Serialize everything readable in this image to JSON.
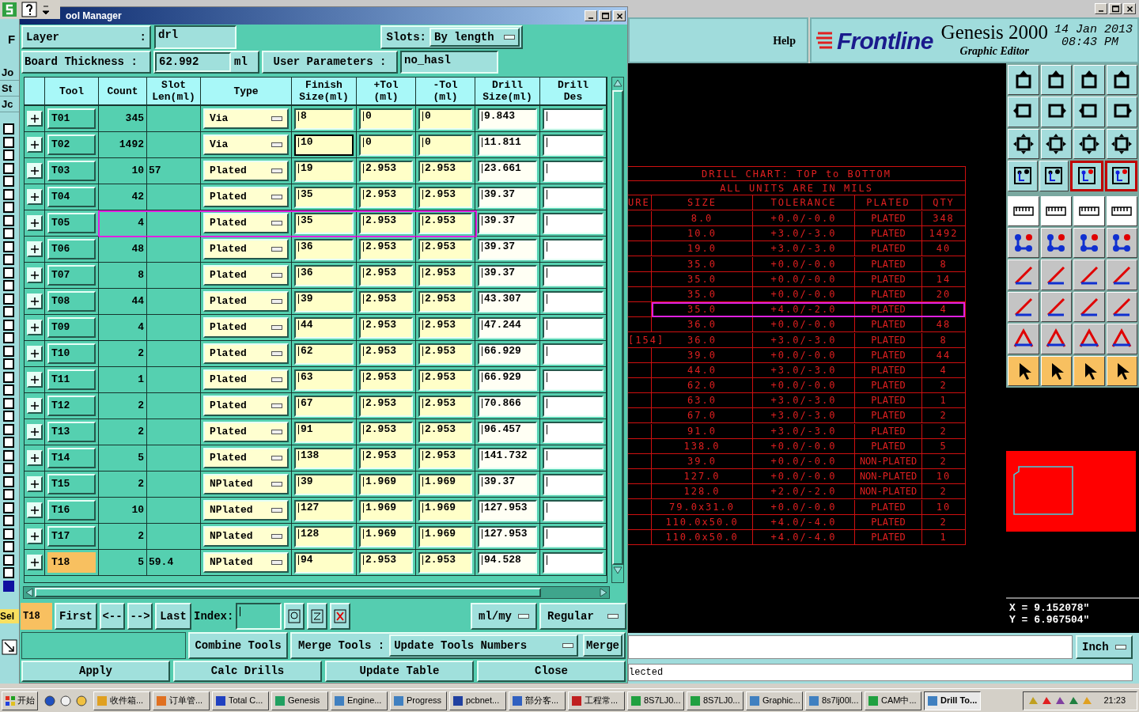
{
  "genesis": {
    "help": "Help",
    "brand": "Frontline",
    "product": "Genesis 2000",
    "subtitle": "Graphic Editor",
    "date": "14 Jan 2013",
    "time": "08:43 PM",
    "header_label": "F",
    "left_labels": [
      "Jo",
      "St",
      "Jc"
    ],
    "sel_label": "Sel",
    "layer_icons": [
      {
        "selected": false
      },
      {
        "selected": false
      },
      {
        "selected": false
      },
      {
        "selected": false
      },
      {
        "selected": false
      },
      {
        "selected": false
      },
      {
        "selected": false
      },
      {
        "selected": false
      },
      {
        "selected": false
      },
      {
        "selected": false
      },
      {
        "selected": false
      },
      {
        "selected": false
      },
      {
        "selected": false
      },
      {
        "selected": false
      },
      {
        "selected": false
      },
      {
        "selected": false
      },
      {
        "selected": false
      },
      {
        "selected": false
      },
      {
        "selected": false
      },
      {
        "selected": false
      },
      {
        "selected": false
      },
      {
        "selected": false
      },
      {
        "selected": false
      },
      {
        "selected": false
      },
      {
        "selected": false
      },
      {
        "selected": false
      },
      {
        "selected": false
      },
      {
        "selected": false
      },
      {
        "selected": false
      },
      {
        "selected": false
      },
      {
        "selected": false
      },
      {
        "selected": false
      },
      {
        "selected": false
      },
      {
        "selected": false
      },
      {
        "selected": false
      },
      {
        "selected": true
      }
    ],
    "toolbar": [
      {
        "kind": "view",
        "on": [
          false,
          false,
          false,
          false
        ]
      },
      {
        "kind": "view",
        "on": [
          false,
          false,
          false,
          false
        ]
      },
      {
        "kind": "view",
        "on": [
          false,
          false,
          false,
          false
        ]
      },
      {
        "kind": "view",
        "on": [
          false,
          false,
          true,
          true
        ]
      },
      {
        "kind": "measure",
        "on": [
          false,
          false,
          false,
          false
        ]
      },
      {
        "kind": "edit",
        "on": [
          false,
          false,
          false,
          false
        ]
      },
      {
        "kind": "edit",
        "on": [
          false,
          false,
          false,
          false
        ]
      },
      {
        "kind": "edit",
        "on": [
          false,
          false,
          false,
          false
        ]
      },
      {
        "kind": "edit",
        "on": [
          false,
          false,
          false,
          false
        ]
      },
      {
        "kind": "select",
        "on": [
          false,
          false,
          false,
          false
        ]
      }
    ],
    "coords": [
      "X = 9.152078\"",
      "Y = 6.967504\""
    ],
    "units": "Inch",
    "status": "lected"
  },
  "drill_chart": {
    "title": "DRILL CHART: TOP to BOTTOM",
    "subtitle": "ALL UNITS ARE IN MILS",
    "columns": [
      "URE",
      "SIZE",
      "TOLERANCE",
      "PLATED",
      "QTY"
    ],
    "rows": [
      {
        "size": "8.0",
        "tolerance": "+0.0/-0.0",
        "plated": "PLATED",
        "qty": "348",
        "selected": false
      },
      {
        "size": "10.0",
        "tolerance": "+3.0/-3.0",
        "plated": "PLATED",
        "qty": "1492",
        "selected": false
      },
      {
        "size": "19.0",
        "tolerance": "+3.0/-3.0",
        "plated": "PLATED",
        "qty": "40",
        "selected": false
      },
      {
        "size": "35.0",
        "tolerance": "+0.0/-0.0",
        "plated": "PLATED",
        "qty": "8",
        "selected": false
      },
      {
        "size": "35.0",
        "tolerance": "+0.0/-0.0",
        "plated": "PLATED",
        "qty": "14",
        "selected": false
      },
      {
        "size": "35.0",
        "tolerance": "+0.0/-0.0",
        "plated": "PLATED",
        "qty": "20",
        "selected": false
      },
      {
        "size": "35.0",
        "tolerance": "+4.0/-2.0",
        "plated": "PLATED",
        "qty": "4",
        "selected": true
      },
      {
        "size": "36.0",
        "tolerance": "+0.0/-0.0",
        "plated": "PLATED",
        "qty": "48",
        "selected": false
      },
      {
        "mark": "[154]",
        "size": "36.0",
        "tolerance": "+3.0/-3.0",
        "plated": "PLATED",
        "qty": "8",
        "selected": false
      },
      {
        "size": "39.0",
        "tolerance": "+0.0/-0.0",
        "plated": "PLATED",
        "qty": "44",
        "selected": false
      },
      {
        "size": "44.0",
        "tolerance": "+3.0/-3.0",
        "plated": "PLATED",
        "qty": "4",
        "selected": false
      },
      {
        "size": "62.0",
        "tolerance": "+0.0/-0.0",
        "plated": "PLATED",
        "qty": "2",
        "selected": false
      },
      {
        "size": "63.0",
        "tolerance": "+3.0/-3.0",
        "plated": "PLATED",
        "qty": "1",
        "selected": false
      },
      {
        "size": "67.0",
        "tolerance": "+3.0/-3.0",
        "plated": "PLATED",
        "qty": "2",
        "selected": false
      },
      {
        "size": "91.0",
        "tolerance": "+3.0/-3.0",
        "plated": "PLATED",
        "qty": "2",
        "selected": false
      },
      {
        "size": "138.0",
        "tolerance": "+0.0/-0.0",
        "plated": "PLATED",
        "qty": "5",
        "selected": false
      },
      {
        "size": "39.0",
        "tolerance": "+0.0/-0.0",
        "plated": "NON-PLATED",
        "qty": "2",
        "selected": false
      },
      {
        "size": "127.0",
        "tolerance": "+0.0/-0.0",
        "plated": "NON-PLATED",
        "qty": "10",
        "selected": false
      },
      {
        "size": "128.0",
        "tolerance": "+2.0/-2.0",
        "plated": "NON-PLATED",
        "qty": "2",
        "selected": false
      },
      {
        "size": "79.0x31.0",
        "tolerance": "+0.0/-0.0",
        "plated": "PLATED",
        "qty": "10",
        "selected": false
      },
      {
        "size": "110.0x50.0",
        "tolerance": "+4.0/-4.0",
        "plated": "PLATED",
        "qty": "2",
        "selected": false
      },
      {
        "size": "110.0x50.0",
        "tolerance": "+4.0/-4.0",
        "plated": "PLATED",
        "qty": "1",
        "selected": false
      }
    ]
  },
  "tool_manager": {
    "title": "ool Manager",
    "layer": {
      "label": "Layer",
      "colon": ":",
      "value": "drl"
    },
    "slots": {
      "label": "Slots:",
      "value": "By length"
    },
    "thickness": {
      "label": "Board Thickness :",
      "value": "62.992",
      "unit": "ml"
    },
    "user_params": {
      "label": "User Parameters :",
      "value": "no_hasl"
    },
    "columns": [
      {
        "lines": [
          "Tool"
        ]
      },
      {
        "lines": [
          "Count"
        ]
      },
      {
        "lines": [
          "Slot",
          "Len(ml)"
        ]
      },
      {
        "lines": [
          "Type"
        ]
      },
      {
        "lines": [
          "Finish",
          "Size(ml)"
        ]
      },
      {
        "lines": [
          "+Tol",
          "(ml)"
        ]
      },
      {
        "lines": [
          "-Tol",
          "(ml)"
        ]
      },
      {
        "lines": [
          "Drill",
          "Size(ml)"
        ]
      },
      {
        "lines": [
          "Drill",
          "Des"
        ]
      }
    ],
    "rows": [
      {
        "tool": "T01",
        "count": "345",
        "type": "Via",
        "finish": "8",
        "plus_tol": "0",
        "minus_tol": "0",
        "drill": "9.843",
        "focused": false,
        "highlighted": false,
        "current": false
      },
      {
        "tool": "T02",
        "count": "1492",
        "type": "Via",
        "finish": "10",
        "plus_tol": "0",
        "minus_tol": "0",
        "drill": "11.811",
        "focused": true,
        "highlighted": false,
        "current": false
      },
      {
        "tool": "T03",
        "count": "10",
        "slot": "57",
        "type": "Plated",
        "finish": "19",
        "plus_tol": "2.953",
        "minus_tol": "2.953",
        "drill": "23.661",
        "focused": false,
        "highlighted": false,
        "current": false
      },
      {
        "tool": "T04",
        "count": "42",
        "type": "Plated",
        "finish": "35",
        "plus_tol": "2.953",
        "minus_tol": "2.953",
        "drill": "39.37",
        "focused": false,
        "highlighted": false,
        "current": false
      },
      {
        "tool": "T05",
        "count": "4",
        "type": "Plated",
        "finish": "35",
        "plus_tol": "2.953",
        "minus_tol": "2.953",
        "drill": "39.37",
        "focused": false,
        "highlighted": true,
        "current": false
      },
      {
        "tool": "T06",
        "count": "48",
        "type": "Plated",
        "finish": "36",
        "plus_tol": "2.953",
        "minus_tol": "2.953",
        "drill": "39.37",
        "focused": false,
        "highlighted": false,
        "current": false
      },
      {
        "tool": "T07",
        "count": "8",
        "type": "Plated",
        "finish": "36",
        "plus_tol": "2.953",
        "minus_tol": "2.953",
        "drill": "39.37",
        "focused": false,
        "highlighted": false,
        "current": false
      },
      {
        "tool": "T08",
        "count": "44",
        "type": "Plated",
        "finish": "39",
        "plus_tol": "2.953",
        "minus_tol": "2.953",
        "drill": "43.307",
        "focused": false,
        "highlighted": false,
        "current": false
      },
      {
        "tool": "T09",
        "count": "4",
        "type": "Plated",
        "finish": "44",
        "plus_tol": "2.953",
        "minus_tol": "2.953",
        "drill": "47.244",
        "focused": false,
        "highlighted": false,
        "current": false
      },
      {
        "tool": "T10",
        "count": "2",
        "type": "Plated",
        "finish": "62",
        "plus_tol": "2.953",
        "minus_tol": "2.953",
        "drill": "66.929",
        "focused": false,
        "highlighted": false,
        "current": false
      },
      {
        "tool": "T11",
        "count": "1",
        "type": "Plated",
        "finish": "63",
        "plus_tol": "2.953",
        "minus_tol": "2.953",
        "drill": "66.929",
        "focused": false,
        "highlighted": false,
        "current": false
      },
      {
        "tool": "T12",
        "count": "2",
        "type": "Plated",
        "finish": "67",
        "plus_tol": "2.953",
        "minus_tol": "2.953",
        "drill": "70.866",
        "focused": false,
        "highlighted": false,
        "current": false
      },
      {
        "tool": "T13",
        "count": "2",
        "type": "Plated",
        "finish": "91",
        "plus_tol": "2.953",
        "minus_tol": "2.953",
        "drill": "96.457",
        "focused": false,
        "highlighted": false,
        "current": false
      },
      {
        "tool": "T14",
        "count": "5",
        "type": "Plated",
        "finish": "138",
        "plus_tol": "2.953",
        "minus_tol": "2.953",
        "drill": "141.732",
        "focused": false,
        "highlighted": false,
        "current": false
      },
      {
        "tool": "T15",
        "count": "2",
        "type": "NPlated",
        "finish": "39",
        "plus_tol": "1.969",
        "minus_tol": "1.969",
        "drill": "39.37",
        "focused": false,
        "highlighted": false,
        "current": false
      },
      {
        "tool": "T16",
        "count": "10",
        "type": "NPlated",
        "finish": "127",
        "plus_tol": "1.969",
        "minus_tol": "1.969",
        "drill": "127.953",
        "focused": false,
        "highlighted": false,
        "current": false
      },
      {
        "tool": "T17",
        "count": "2",
        "type": "NPlated",
        "finish": "128",
        "plus_tol": "1.969",
        "minus_tol": "1.969",
        "drill": "127.953",
        "focused": false,
        "highlighted": false,
        "current": false
      },
      {
        "tool": "T18",
        "count": "5",
        "slot": "59.4",
        "type": "NPlated",
        "finish": "94",
        "plus_tol": "2.953",
        "minus_tol": "2.953",
        "drill": "94.528",
        "focused": false,
        "highlighted": false,
        "current": true
      }
    ],
    "nav": {
      "current": "T18",
      "first": "First",
      "prev": "<--",
      "next": "-->",
      "last": "Last",
      "index_label": "Index:",
      "units": "ml/my",
      "mode": "Regular"
    },
    "merge": {
      "combine": "Combine Tools",
      "label": "Merge Tools :",
      "option": "Update Tools Numbers",
      "merge": "Merge"
    },
    "actions": [
      "Apply",
      "Calc Drills",
      "Update Table",
      "Close"
    ]
  },
  "taskbar": {
    "start": "开始",
    "tasks": [
      {
        "label": "收件箱...",
        "selected": false
      },
      {
        "label": "订单管...",
        "selected": false
      },
      {
        "label": "Total C...",
        "selected": false
      },
      {
        "label": "Genesis",
        "selected": false
      },
      {
        "label": "Engine...",
        "selected": false
      },
      {
        "label": "Progress",
        "selected": false
      },
      {
        "label": "pcbnet...",
        "selected": false
      },
      {
        "label": "部分客...",
        "selected": false
      },
      {
        "label": "工程常...",
        "selected": false
      },
      {
        "label": "8S7LJ0...",
        "selected": false
      },
      {
        "label": "8S7LJ0...",
        "selected": false
      },
      {
        "label": "Graphic...",
        "selected": false
      },
      {
        "label": "8s7lj00l...",
        "selected": false
      },
      {
        "label": "CAM中...",
        "selected": false
      },
      {
        "label": "Drill To...",
        "selected": true
      }
    ],
    "clock": "21:23"
  }
}
